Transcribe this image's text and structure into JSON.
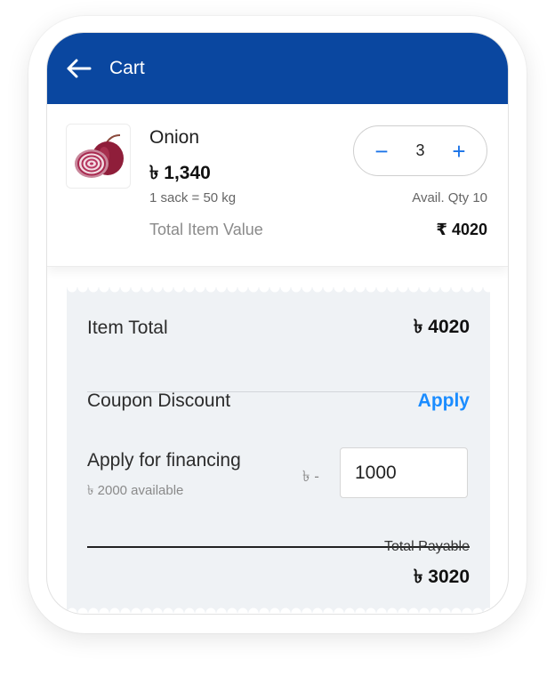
{
  "header": {
    "title": "Cart",
    "back_icon": "arrow-left-icon"
  },
  "product": {
    "name": "Onion",
    "price": "৳ 1,340",
    "unit": "1 sack = 50 kg",
    "available": "Avail. Qty 10",
    "total_label": "Total Item Value",
    "total_value": "₹ 4020",
    "image_icon": "onion-image",
    "quantity": "3",
    "decrement_label": "−",
    "increment_label": "+"
  },
  "bill": {
    "item_total_label": "Item Total",
    "item_total_value": "৳ 4020",
    "coupon_label": "Coupon Discount",
    "coupon_action": "Apply",
    "financing_label": "Apply for financing",
    "financing_available": "৳ 2000 available",
    "financing_prefix": "৳ -",
    "financing_value": "1000",
    "payable_label": "Total Payable",
    "payable_value": "৳ 3020"
  },
  "colors": {
    "header_bg": "#0a47a0",
    "accent": "#1a73e8",
    "apply_link": "#1a8cff",
    "bill_bg": "#eff2f5"
  }
}
